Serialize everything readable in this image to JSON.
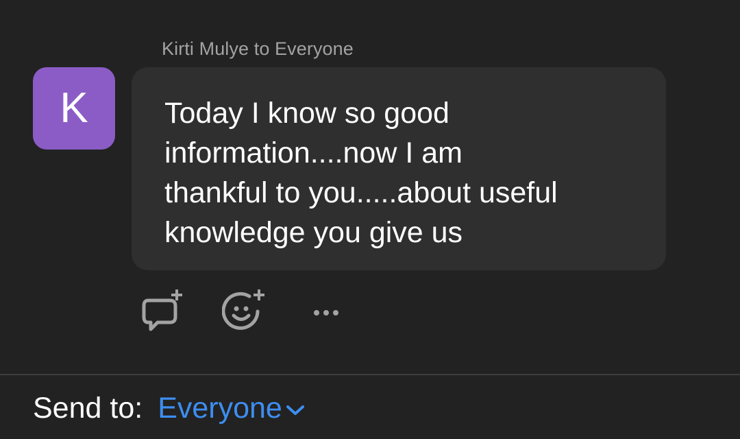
{
  "message": {
    "sender_line": "Kirti Mulye to Everyone",
    "avatar_initial": "K",
    "text": "Today I know so good\ninformation....now I am\nthankful to you.....about useful\nknowledge you give us"
  },
  "actions": [
    {
      "icon": "reply-icon"
    },
    {
      "icon": "add-reaction-icon"
    },
    {
      "icon": "more-icon"
    }
  ],
  "footer": {
    "label": "Send to:",
    "recipient": "Everyone"
  },
  "colors": {
    "background": "#222222",
    "bubble": "#2f2f2f",
    "avatar": "#8b5cc6",
    "accent": "#3d8ef0"
  }
}
